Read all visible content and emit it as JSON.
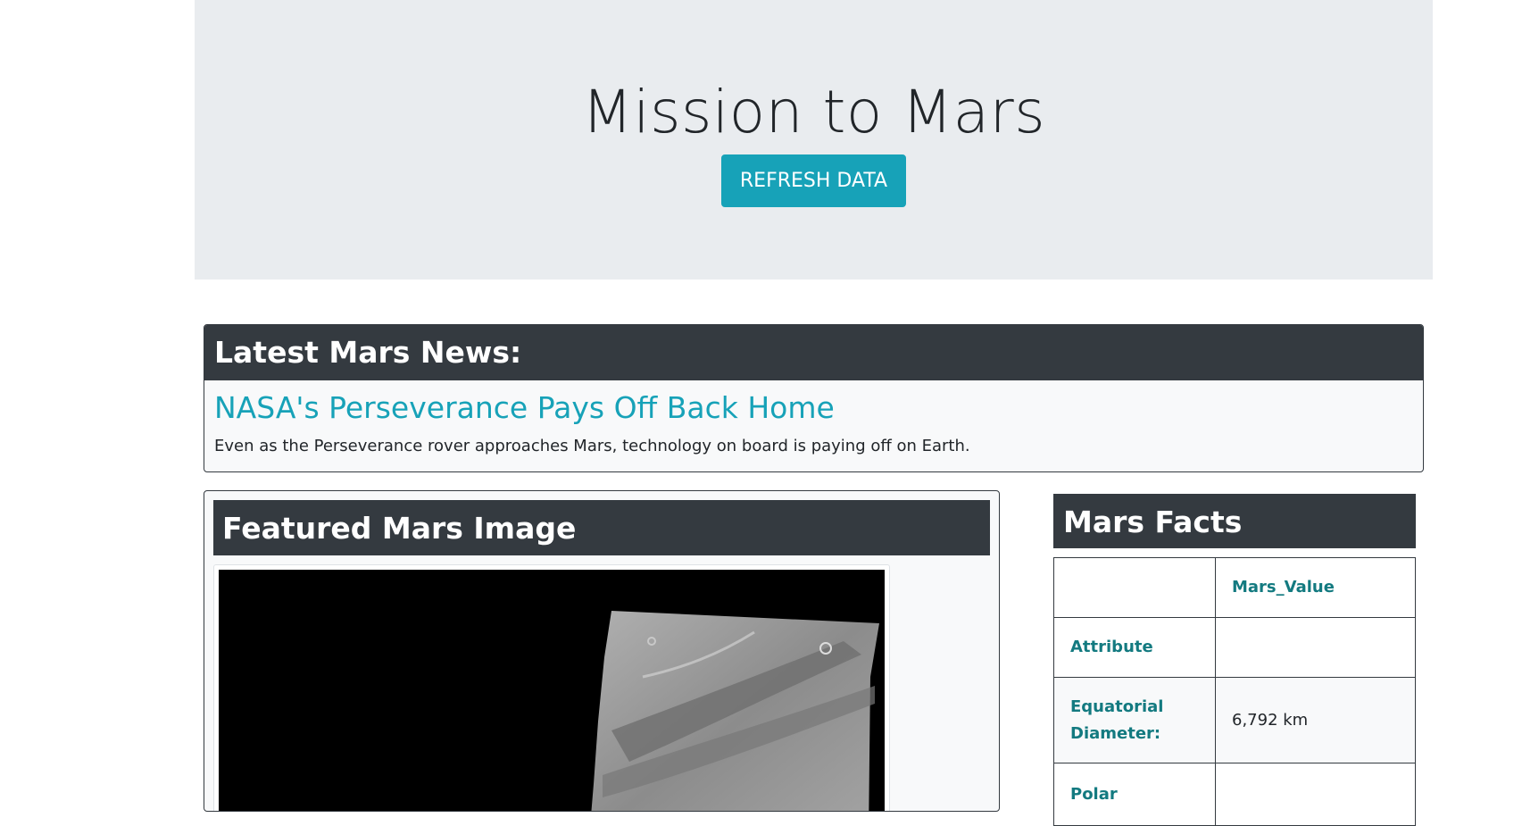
{
  "jumbotron": {
    "title": "Mission to Mars",
    "refresh_label": "REFRESH DATA"
  },
  "news": {
    "header": "Latest Mars News:",
    "title": "NASA's Perseverance Pays Off Back Home",
    "teaser": "Even as the Perseverance rover approaches Mars, technology on board is paying off on Earth."
  },
  "featured_image": {
    "header": "Featured Mars Image"
  },
  "facts": {
    "header": "Mars Facts",
    "column_header": "Mars_Value",
    "rows": [
      {
        "label": "Attribute",
        "value": ""
      },
      {
        "label": "Equatorial Diameter:",
        "value": "6,792 km"
      },
      {
        "label": "Polar",
        "value": ""
      }
    ]
  },
  "colors": {
    "accent": "#17a2b8",
    "dark": "#343a40",
    "jumbotron_bg": "#e9ecef",
    "table_header_text": "#137a80"
  }
}
